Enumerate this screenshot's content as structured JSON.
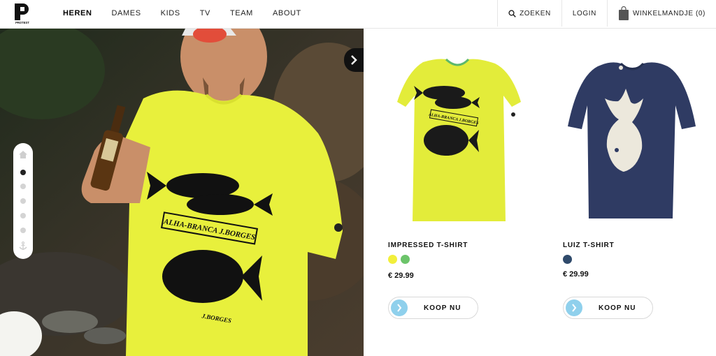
{
  "brand": {
    "logo_text": "PROTEST"
  },
  "nav": {
    "items": [
      {
        "label": "HEREN",
        "active": true
      },
      {
        "label": "DAMES"
      },
      {
        "label": "KIDS"
      },
      {
        "label": "TV"
      },
      {
        "label": "TEAM"
      },
      {
        "label": "ABOUT"
      }
    ]
  },
  "header_right": {
    "search_label": "ZOEKEN",
    "login_label": "LOGIN",
    "cart_label": "WINKELMANDJE (0)"
  },
  "hero": {
    "shirt_print_text": "ALHA-BRANCA J.BORGES",
    "shirt_print_text2": "J.BORGES",
    "pager": {
      "count": 5,
      "active_index": 0
    }
  },
  "products": [
    {
      "name": "IMPRESSED T-SHIRT",
      "swatches": [
        "#f2ef3b",
        "#6cc46a"
      ],
      "price": "€ 29.99",
      "buy_label": "KOOP NU",
      "shirt_color": "#e4ee3a",
      "print_text": "ALHA-BRANCA J.BORGES"
    },
    {
      "name": "LUIZ T-SHIRT",
      "swatches": [
        "#2f4a6b"
      ],
      "price": "€ 29.99",
      "buy_label": "KOOP NU",
      "shirt_color": "#2f3b63"
    }
  ],
  "colors": {
    "accent": "#8fd0ec",
    "shirt_yellow": "#e8f03c",
    "navy": "#2f3b63"
  }
}
